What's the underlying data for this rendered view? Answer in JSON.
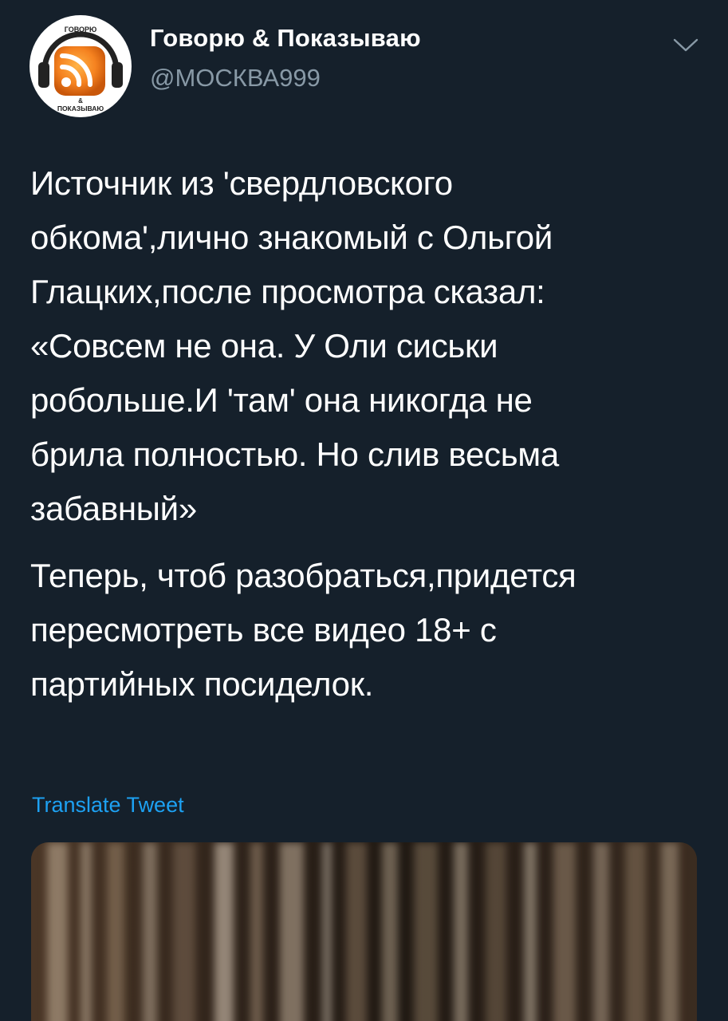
{
  "author": {
    "avatar_top_text": "ГОВОРЮ",
    "avatar_mid_text": "&",
    "avatar_bottom_text": "ПОКАЗЫВАЮ",
    "name": "Говорю & Показываю",
    "handle": "@МОСКВА999"
  },
  "tweet": {
    "paragraphs": [
      "Источник из 'свердловского\nобкома',лично знакомый с Ольгой\nГлацких,после просмотра сказал:\n«Совсем не она. У Оли сиськи\npобольше.И 'там' она никогда не\nбрила полностью. Но слив весьма\nзабавный»",
      "Теперь, чтоб разобраться,придется\nпересмотреть все видео 18+ с\nпартийных посиделок."
    ]
  },
  "translate_label": "Translate Tweet",
  "icons": {
    "avatar": "rss-headphones-logo-icon",
    "menu": "chevron-down-icon"
  },
  "colors": {
    "background": "#15202b",
    "text": "#ffffff",
    "secondary": "#8899a6",
    "accent": "#1da1f2",
    "avatar_orange": "#f58220"
  }
}
